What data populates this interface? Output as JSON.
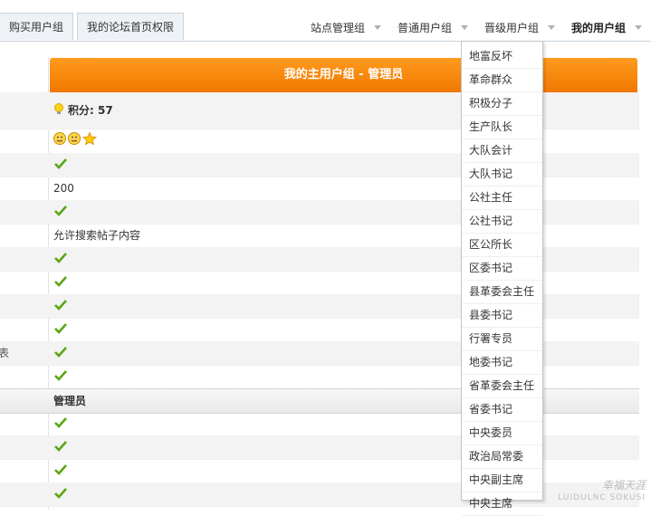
{
  "tabs": [
    "购买用户组",
    "我的论坛首页权限"
  ],
  "group_nav": [
    {
      "label": "站点管理组",
      "bold": false
    },
    {
      "label": "普通用户组",
      "bold": false
    },
    {
      "label": "晋级用户组",
      "bold": false
    },
    {
      "label": "我的用户组",
      "bold": true
    }
  ],
  "table": {
    "header": "我的主用户组 - 管理员",
    "points_label": "积分: 57",
    "value_200": "200",
    "search_text": "允许搜索帖子内容",
    "left_fragment": "表",
    "section_label": "管理员"
  },
  "dropdown_items": [
    "地富反坏",
    "革命群众",
    "积极分子",
    "生产队长",
    "大队会计",
    "大队书记",
    "公社主任",
    "公社书记",
    "区公所长",
    "区委书记",
    "县革委会主任",
    "县委书记",
    "行署专员",
    "地委书记",
    "省革委会主任",
    "省委书记",
    "中央委员",
    "政治局常委",
    "中央副主席",
    "中央主席"
  ],
  "watermark": {
    "line1": "幸福天涯",
    "line2": "LUIDULNC SOKUSI"
  },
  "colors": {
    "accent": "#f07800",
    "check": "#5aa514"
  },
  "icons": {
    "points": "lightbulb-icon",
    "stars": "smiley-star-icons",
    "check": "checkmark-icon"
  }
}
